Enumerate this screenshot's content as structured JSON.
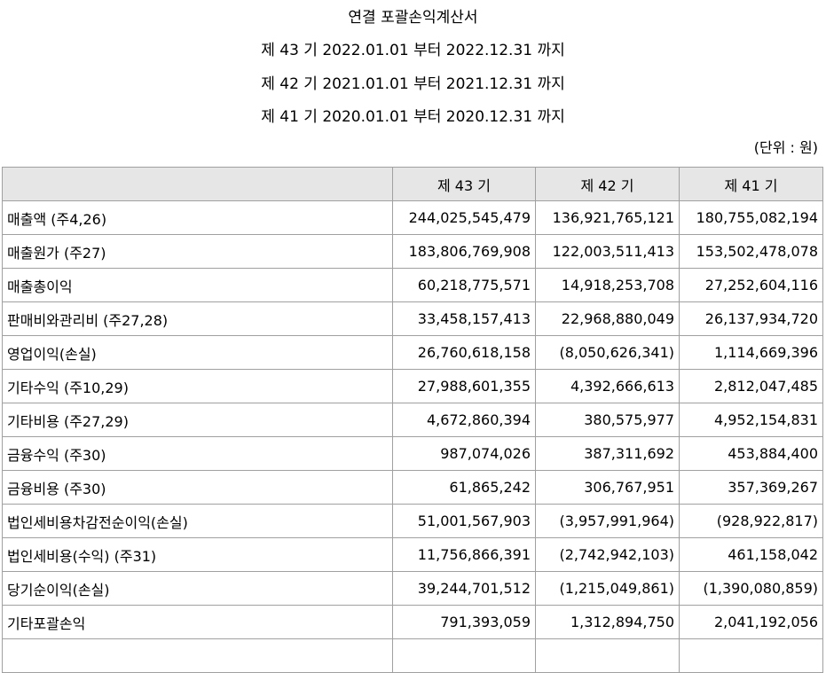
{
  "header": {
    "title": "연결 포괄손익계산서",
    "periods": [
      "제 43 기 2022.01.01 부터 2022.12.31 까지",
      "제 42 기 2021.01.01 부터 2021.12.31 까지",
      "제 41 기 2020.01.01 부터 2020.12.31 까지"
    ],
    "unit": "(단위 : 원)"
  },
  "table": {
    "columns": [
      "",
      "제 43 기",
      "제 42 기",
      "제 41 기"
    ],
    "rows": [
      {
        "label": "매출액 (주4,26)",
        "values": [
          "244,025,545,479",
          "136,921,765,121",
          "180,755,082,194"
        ]
      },
      {
        "label": "매출원가 (주27)",
        "values": [
          "183,806,769,908",
          "122,003,511,413",
          "153,502,478,078"
        ]
      },
      {
        "label": "매출총이익",
        "values": [
          "60,218,775,571",
          "14,918,253,708",
          "27,252,604,116"
        ]
      },
      {
        "label": "판매비와관리비 (주27,28)",
        "values": [
          "33,458,157,413",
          "22,968,880,049",
          "26,137,934,720"
        ]
      },
      {
        "label": "영업이익(손실)",
        "values": [
          "26,760,618,158",
          "(8,050,626,341)",
          "1,114,669,396"
        ]
      },
      {
        "label": "기타수익 (주10,29)",
        "values": [
          "27,988,601,355",
          "4,392,666,613",
          "2,812,047,485"
        ]
      },
      {
        "label": "기타비용 (주27,29)",
        "values": [
          "4,672,860,394",
          "380,575,977",
          "4,952,154,831"
        ]
      },
      {
        "label": "금융수익 (주30)",
        "values": [
          "987,074,026",
          "387,311,692",
          "453,884,400"
        ]
      },
      {
        "label": "금융비용 (주30)",
        "values": [
          "61,865,242",
          "306,767,951",
          "357,369,267"
        ]
      },
      {
        "label": "법인세비용차감전순이익(손실)",
        "values": [
          "51,001,567,903",
          "(3,957,991,964)",
          "(928,922,817)"
        ]
      },
      {
        "label": "법인세비용(수익) (주31)",
        "values": [
          "11,756,866,391",
          "(2,742,942,103)",
          "461,158,042"
        ]
      },
      {
        "label": "당기순이익(손실)",
        "values": [
          "39,244,701,512",
          "(1,215,049,861)",
          "(1,390,080,859)"
        ]
      },
      {
        "label": "기타포괄손익",
        "values": [
          "791,393,059",
          "1,312,894,750",
          "2,041,192,056"
        ]
      },
      {
        "label": "",
        "values": [
          "",
          "",
          ""
        ]
      }
    ]
  }
}
